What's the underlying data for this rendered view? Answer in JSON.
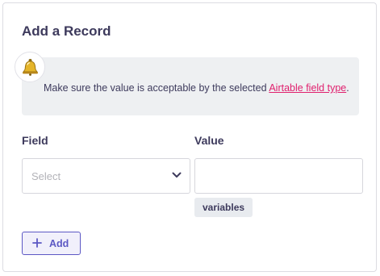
{
  "panel": {
    "title": "Add a Record"
  },
  "notice": {
    "icon": "bell-icon",
    "text_before": "Make sure the value is acceptable by the selected ",
    "link_text": "Airtable field type",
    "text_after": "."
  },
  "fields": {
    "field_label": "Field",
    "value_label": "Value",
    "select_placeholder": "Select",
    "value_input_value": "",
    "variables_label": "variables"
  },
  "actions": {
    "add_label": "Add"
  },
  "colors": {
    "accent": "#5c58c4",
    "link": "#e0206e",
    "notice_bg": "#eef0f2",
    "text": "#3d3a5c"
  }
}
